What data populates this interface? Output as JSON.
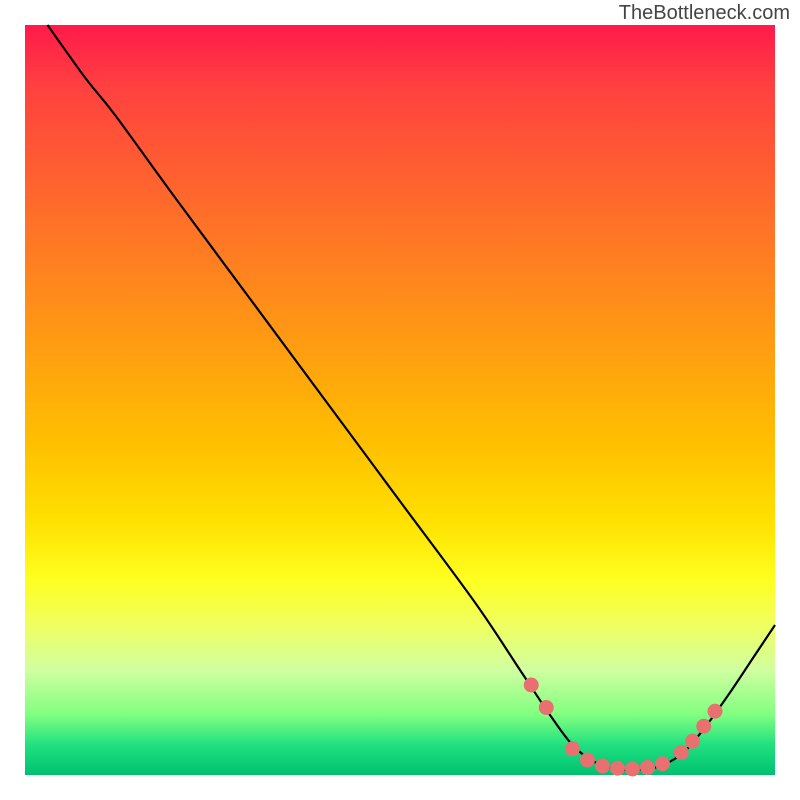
{
  "watermark": "TheBottleneck.com",
  "chart_data": {
    "type": "line",
    "title": "",
    "xlabel": "",
    "ylabel": "",
    "xlim": [
      0,
      100
    ],
    "ylim": [
      0,
      100
    ],
    "curve": [
      {
        "x": 3,
        "y": 100
      },
      {
        "x": 8,
        "y": 93
      },
      {
        "x": 12,
        "y": 88
      },
      {
        "x": 20,
        "y": 77
      },
      {
        "x": 30,
        "y": 63.5
      },
      {
        "x": 40,
        "y": 50
      },
      {
        "x": 50,
        "y": 36.5
      },
      {
        "x": 60,
        "y": 23
      },
      {
        "x": 66,
        "y": 14
      },
      {
        "x": 70,
        "y": 8
      },
      {
        "x": 73,
        "y": 4
      },
      {
        "x": 76,
        "y": 1.7
      },
      {
        "x": 79,
        "y": 0.8
      },
      {
        "x": 82,
        "y": 0.7
      },
      {
        "x": 85,
        "y": 1.3
      },
      {
        "x": 88,
        "y": 3.2
      },
      {
        "x": 91,
        "y": 6.8
      },
      {
        "x": 94,
        "y": 11
      },
      {
        "x": 97,
        "y": 15.5
      },
      {
        "x": 100,
        "y": 20
      }
    ],
    "dots": [
      {
        "x": 67.5,
        "y": 12
      },
      {
        "x": 69.5,
        "y": 9
      },
      {
        "x": 73,
        "y": 3.5
      },
      {
        "x": 75,
        "y": 2
      },
      {
        "x": 77,
        "y": 1.2
      },
      {
        "x": 79,
        "y": 0.9
      },
      {
        "x": 81,
        "y": 0.8
      },
      {
        "x": 83,
        "y": 1.0
      },
      {
        "x": 85,
        "y": 1.5
      },
      {
        "x": 87.5,
        "y": 3
      },
      {
        "x": 89,
        "y": 4.5
      },
      {
        "x": 90.5,
        "y": 6.5
      },
      {
        "x": 92,
        "y": 8.5
      }
    ]
  }
}
